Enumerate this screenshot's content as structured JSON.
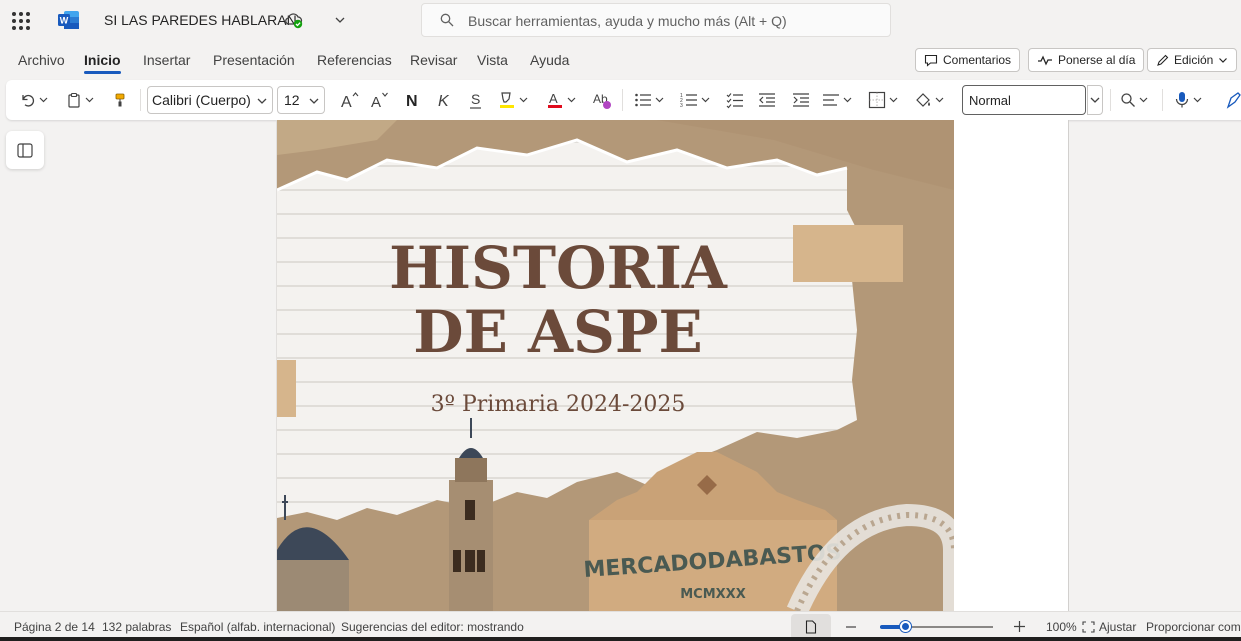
{
  "titlebar": {
    "doc_title": "SI LAS PAREDES HABLARAN",
    "search_placeholder": "Buscar herramientas, ayuda y mucho más (Alt + Q)"
  },
  "menu": {
    "tabs": [
      "Archivo",
      "Inicio",
      "Insertar",
      "Presentación",
      "Referencias",
      "Revisar",
      "Vista",
      "Ayuda"
    ],
    "active_tab": "Inicio",
    "comments_label": "Comentarios",
    "catchup_label": "Ponerse al día",
    "editing_label": "Edición"
  },
  "ribbon": {
    "font_name": "Calibri (Cuerpo)",
    "font_size": "12",
    "style_name": "Normal"
  },
  "document": {
    "title_line1": "HISTORIA",
    "title_line2": "DE ASPE",
    "subtitle": "3º Primaria 2024-2025",
    "sign_text": "MERCADODABASTOS",
    "sign_year": "MCMXXX"
  },
  "status": {
    "page": "Página 2 de 14",
    "words": "132 palabras",
    "language": "Español (alfab. internacional)",
    "editor": "Sugerencias del editor: mostrando",
    "zoom": "100%",
    "zoom_fraction": 0.23,
    "fit_label": "Ajustar",
    "feedback_label": "Proporcionar com"
  },
  "colors": {
    "accent": "#185abd",
    "word_blue": "#185abd",
    "title_brown": "#6b4a3a",
    "paper_tan": "#b49a78"
  }
}
